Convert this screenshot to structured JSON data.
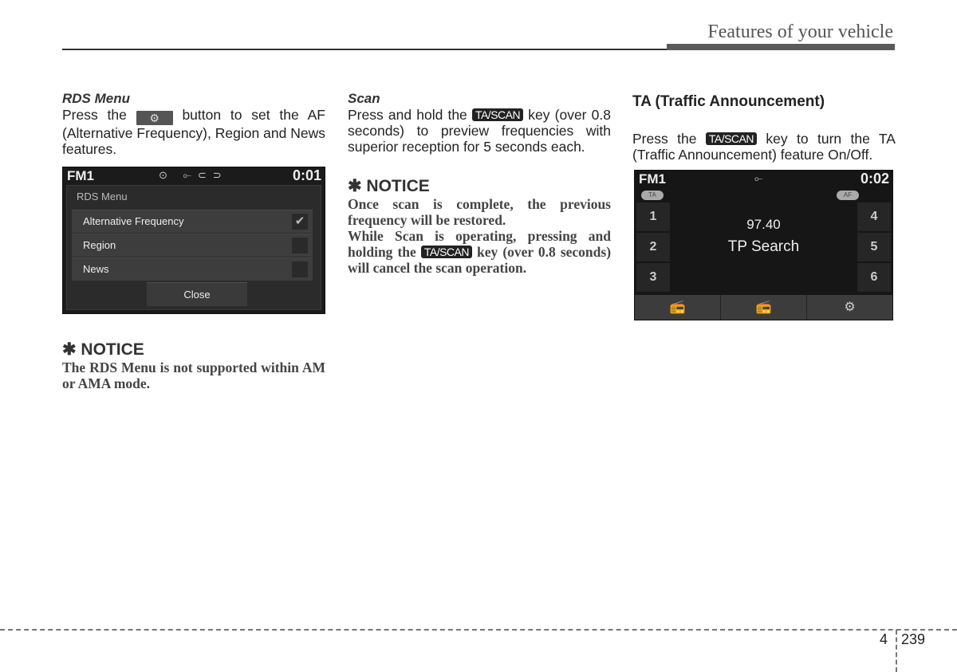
{
  "header": {
    "title": "Features of your vehicle"
  },
  "col1": {
    "subhead": "RDS Menu",
    "body_pre": "Press the",
    "body_post": "button to set the AF (Alternative Frequency), Region and News features.",
    "gear_icon": "gear-icon",
    "screen": {
      "band": "FM1",
      "time": "0:01",
      "status_icons": "⊙ ⟜⊂⊃",
      "panel_title": "RDS Menu",
      "options": [
        {
          "label": "Alternative Frequency",
          "checked": true,
          "check_glyph": "✔"
        },
        {
          "label": "Region",
          "checked": false,
          "check_glyph": ""
        },
        {
          "label": "News",
          "checked": false,
          "check_glyph": ""
        }
      ],
      "close_label": "Close"
    },
    "notice": {
      "title": "✱ NOTICE",
      "text": "The RDS Menu is not supported within AM or AMA mode."
    }
  },
  "col2": {
    "subhead": "Scan",
    "body_pre": "Press and hold the",
    "key": "TA/SCAN",
    "body_post": "key (over 0.8 seconds) to preview frequencies with superior reception for 5 seconds each.",
    "notice": {
      "title": "✱ NOTICE",
      "text1": "Once scan is complete, the previous frequency will be restored.",
      "text2_pre": "While Scan is operating, pressing and holding the",
      "key": "TA/SCAN",
      "text2_post": "key (over 0.8 seconds) will cancel the scan operation."
    }
  },
  "col3": {
    "heading": "TA (Traffic Announcement)",
    "body_pre": "Press the",
    "key": "TA/SCAN",
    "body_post": "key to turn the TA (Traffic Announcement) feature On/Off.",
    "screen": {
      "band": "FM1",
      "time": "0:02",
      "usb_icon": "⟜",
      "ta_pill": "TA",
      "af_pill": "AF",
      "presets_left": [
        "1",
        "2",
        "3"
      ],
      "presets_right": [
        "4",
        "5",
        "6"
      ],
      "frequency": "97.40",
      "status": "TP Search",
      "bottom_buttons": [
        {
          "icon": "radio-list-icon",
          "glyph": "📻"
        },
        {
          "icon": "radio-icon",
          "glyph": "📻"
        },
        {
          "icon": "gear-icon",
          "glyph": "⚙"
        }
      ]
    }
  },
  "footer": {
    "chapter": "4",
    "page": "239"
  }
}
